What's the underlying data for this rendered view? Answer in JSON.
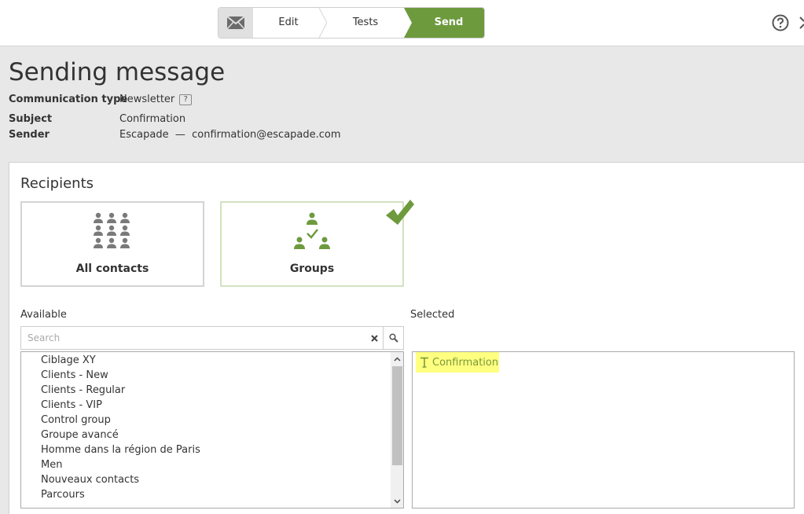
{
  "wizard": {
    "steps": [
      {
        "label": "Edit"
      },
      {
        "label": "Tests"
      },
      {
        "label": "Send"
      }
    ]
  },
  "page": {
    "title": "Sending message"
  },
  "meta": {
    "communication_type_label": "Communication type",
    "communication_type_value": "Newsletter",
    "help_glyph": "?",
    "subject_label": "Subject",
    "subject_value": "Confirmation",
    "sender_label": "Sender",
    "sender_value": "Escapade  —  confirmation@escapade.com"
  },
  "recipients": {
    "title": "Recipients",
    "options": [
      {
        "label": "All contacts",
        "icon": "contacts-grid-icon",
        "selected": false
      },
      {
        "label": "Groups",
        "icon": "groups-hierarchy-icon",
        "selected": true
      }
    ],
    "available_label": "Available",
    "selected_label": "Selected",
    "search": {
      "placeholder": "Search",
      "value": ""
    },
    "available_items": [
      "Ciblage XY",
      "Clients - New",
      "Clients - Regular",
      "Clients - VIP",
      "Control group",
      "Groupe avancé",
      "Homme dans la région de Paris",
      "Men",
      "Nouveaux contacts",
      "Parcours"
    ],
    "selected_items": [
      {
        "label": "Confirmation",
        "icon": "text-type-icon"
      }
    ]
  },
  "colors": {
    "accent_green": "#6e9a3e",
    "highlight_yellow": "#ffff80"
  }
}
